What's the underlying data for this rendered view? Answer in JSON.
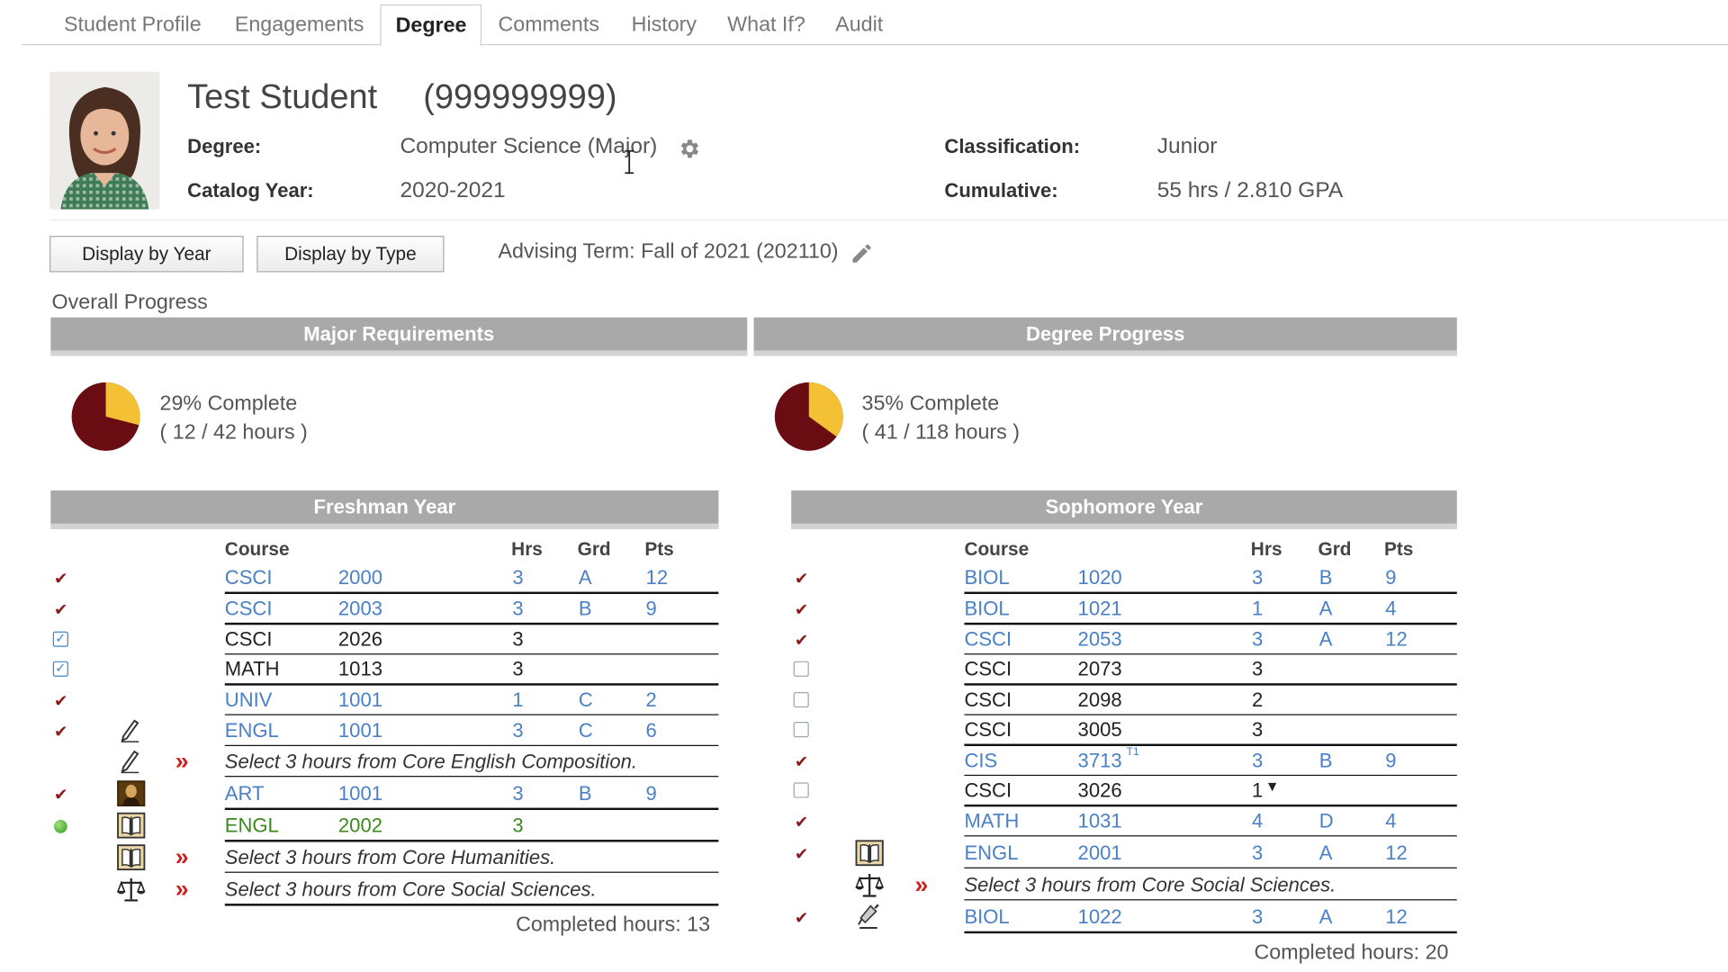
{
  "tabs": [
    "Student Profile",
    "Engagements",
    "Degree",
    "Comments",
    "History",
    "What If?",
    "Audit"
  ],
  "student": {
    "name": "Test Student",
    "id": "(999999999)",
    "degree_label": "Degree:",
    "degree": "Computer Science (Major)",
    "catalog_label": "Catalog Year:",
    "catalog": "2020-2021",
    "classification_label": "Classification:",
    "classification": "Junior",
    "cumulative_label": "Cumulative:",
    "cumulative": "55 hrs / 2.810 GPA"
  },
  "buttons": {
    "by_year": "Display by Year",
    "by_type": "Display by Type"
  },
  "advising_term": "Advising Term: Fall of 2021 (202110)",
  "overall_progress": "Overall Progress",
  "progress": [
    {
      "title": "Major Requirements",
      "percent": 29,
      "pct_text": "29% Complete",
      "hours_text": "( 12 / 42 hours )"
    },
    {
      "title": "Degree Progress",
      "percent": 35,
      "pct_text": "35% Complete",
      "hours_text": "( 41 / 118 hours )"
    }
  ],
  "colors": {
    "pie_complete": "#f4c135",
    "pie_remaining": "#6a0d13",
    "link": "#4a80c7",
    "header_bar": "#a9a9a9"
  },
  "columns": {
    "course": "Course",
    "hrs": "Hrs",
    "grd": "Grd",
    "pts": "Pts"
  },
  "years": [
    {
      "title": "Freshman Year",
      "completed": "Completed hours: 13",
      "rows": [
        {
          "status": "check",
          "icon": "",
          "subject": "CSCI",
          "number": "2000",
          "hrs": "3",
          "grd": "A",
          "pts": "12",
          "style": "blue"
        },
        {
          "status": "check",
          "icon": "",
          "subject": "CSCI",
          "number": "2003",
          "hrs": "3",
          "grd": "B",
          "pts": "9",
          "style": "blue"
        },
        {
          "status": "box-checked",
          "icon": "",
          "subject": "CSCI",
          "number": "2026",
          "hrs": "3",
          "grd": "",
          "pts": "",
          "style": "black"
        },
        {
          "status": "box-checked",
          "icon": "",
          "subject": "MATH",
          "number": "1013",
          "hrs": "3",
          "grd": "",
          "pts": "",
          "style": "black"
        },
        {
          "status": "check",
          "icon": "",
          "subject": "UNIV",
          "number": "1001",
          "hrs": "1",
          "grd": "C",
          "pts": "2",
          "style": "blue"
        },
        {
          "status": "check",
          "icon": "pen-icon",
          "subject": "ENGL",
          "number": "1001",
          "hrs": "3",
          "grd": "C",
          "pts": "6",
          "style": "blue"
        },
        {
          "status": "",
          "icon": "pen-icon",
          "select": "Select 3 hours from Core English Composition."
        },
        {
          "status": "check",
          "icon": "mona-lisa-icon",
          "subject": "ART",
          "number": "1001",
          "hrs": "3",
          "grd": "B",
          "pts": "9",
          "style": "blue"
        },
        {
          "status": "dot",
          "icon": "book-icon",
          "subject": "ENGL",
          "number": "2002",
          "hrs": "3",
          "grd": "",
          "pts": "",
          "style": "green"
        },
        {
          "status": "",
          "icon": "book-icon",
          "select": "Select 3 hours from Core Humanities."
        },
        {
          "status": "",
          "icon": "scales-icon",
          "select": "Select 3 hours from Core Social Sciences."
        }
      ]
    },
    {
      "title": "Sophomore Year",
      "completed": "Completed hours: 20",
      "rows": [
        {
          "status": "check",
          "icon": "",
          "subject": "BIOL",
          "number": "1020",
          "hrs": "3",
          "grd": "B",
          "pts": "9",
          "style": "blue"
        },
        {
          "status": "check",
          "icon": "",
          "subject": "BIOL",
          "number": "1021",
          "hrs": "1",
          "grd": "A",
          "pts": "4",
          "style": "blue"
        },
        {
          "status": "check",
          "icon": "",
          "subject": "CSCI",
          "number": "2053",
          "hrs": "3",
          "grd": "A",
          "pts": "12",
          "style": "blue"
        },
        {
          "status": "box",
          "icon": "",
          "subject": "CSCI",
          "number": "2073",
          "hrs": "3",
          "grd": "",
          "pts": "",
          "style": "black"
        },
        {
          "status": "box",
          "icon": "",
          "subject": "CSCI",
          "number": "2098",
          "hrs": "2",
          "grd": "",
          "pts": "",
          "style": "black"
        },
        {
          "status": "box",
          "icon": "",
          "subject": "CSCI",
          "number": "3005",
          "hrs": "3",
          "grd": "",
          "pts": "",
          "style": "black"
        },
        {
          "status": "check",
          "icon": "",
          "subject": "CIS",
          "number": "3713",
          "number_sup": "T1",
          "hrs": "3",
          "grd": "B",
          "pts": "9",
          "style": "blue"
        },
        {
          "status": "box",
          "icon": "",
          "subject": "CSCI",
          "number": "3026",
          "hrs": "1",
          "hrs_dropdown": true,
          "grd": "",
          "pts": "",
          "style": "black"
        },
        {
          "status": "check",
          "icon": "",
          "subject": "MATH",
          "number": "1031",
          "hrs": "4",
          "grd": "D",
          "pts": "4",
          "style": "blue"
        },
        {
          "status": "check",
          "icon": "book-icon",
          "subject": "ENGL",
          "number": "2001",
          "hrs": "3",
          "grd": "A",
          "pts": "12",
          "style": "blue"
        },
        {
          "status": "",
          "icon": "scales-icon",
          "select": "Select 3 hours from Core Social Sciences."
        },
        {
          "status": "check",
          "icon": "microscope-icon",
          "subject": "BIOL",
          "number": "1022",
          "hrs": "3",
          "grd": "A",
          "pts": "12",
          "style": "blue"
        }
      ]
    }
  ]
}
